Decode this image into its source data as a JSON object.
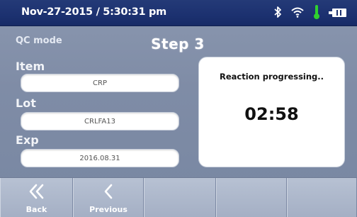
{
  "status_bar": {
    "datetime": "Nov-27-2015 / 5:30:31 pm",
    "icons": [
      "bluetooth-icon",
      "wifi-icon",
      "thermometer-icon",
      "battery-icon"
    ],
    "thermometer_color": "#2fd12f"
  },
  "header": {
    "mode": "QC mode",
    "step": "Step 3"
  },
  "fields": {
    "item": {
      "label": "Item",
      "value": "CRP"
    },
    "lot": {
      "label": "Lot",
      "value": "CRLFA13"
    },
    "exp": {
      "label": "Exp",
      "value": "2016.08.31"
    }
  },
  "reaction": {
    "message": "Reaction progressing..",
    "countdown": "02:58"
  },
  "nav": {
    "back_label": "Back",
    "previous_label": "Previous"
  }
}
